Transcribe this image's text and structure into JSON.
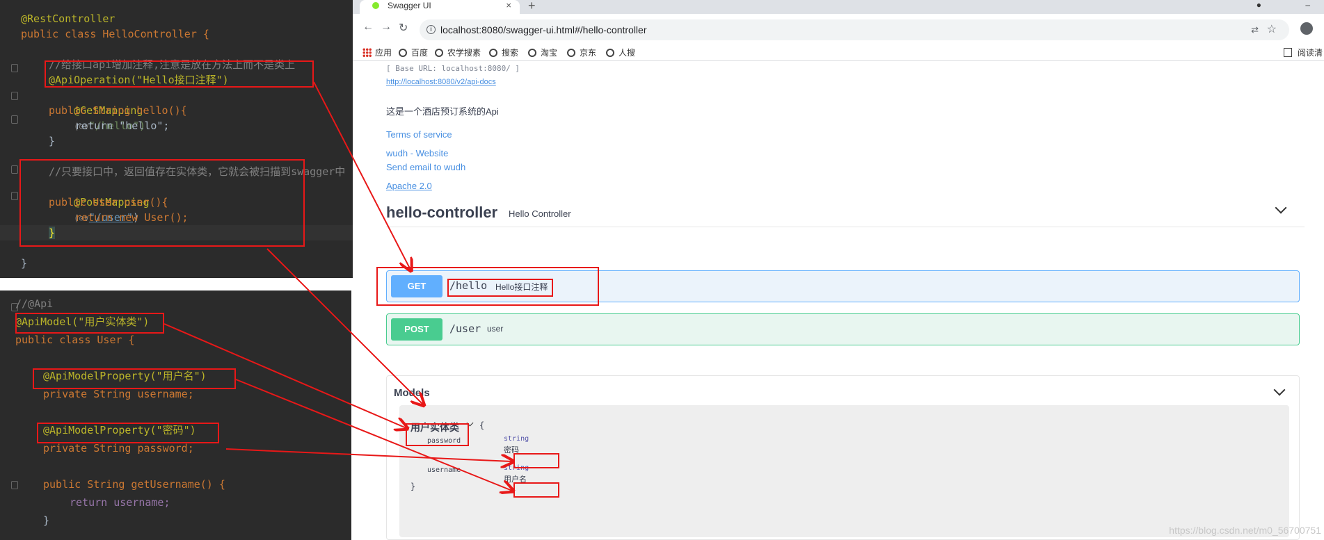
{
  "ide_top": {
    "lines": [
      "@RestController",
      "public class HelloController {",
      "",
      "//给接口api增加注释,注意是放在方法上而不是类上",
      "@ApiOperation(\"Hello接口注释\")",
      "@GetMapping",
      "\"/hello\")",
      "public String hello(){",
      "return \"hello\";",
      "}",
      "",
      "//只要接口中，返回值存在实体类，它就会被扫描到swagger中",
      "@PostMapping",
      "\"/user\"",
      "public User user(){",
      "return new User();",
      "}",
      "",
      "}"
    ],
    "param_hint": "(⊙∨",
    "paren_close": ")"
  },
  "ide_bottom": {
    "comment": "//@Api",
    "api_model": "@ApiModel(\"用户实体类\")",
    "class_decl": "public class User {",
    "prop1_ann": "@ApiModelProperty(\"用户名\")",
    "prop1_field": "private String username;",
    "prop2_ann": "@ApiModelProperty(\"密码\")",
    "prop2_field": "private String password;",
    "getter_decl": "public String getUsername() {",
    "getter_return": "return username;",
    "getter_close": "}"
  },
  "browser": {
    "tab_title": "Swagger UI",
    "tab_close": "×",
    "new_tab": "+",
    "window_controls": [
      "●",
      "–"
    ],
    "url": "localhost:8080/swagger-ui.html#/hello-controller",
    "nav": {
      "back": "←",
      "forward": "→",
      "reload": "↻"
    },
    "translate": "⇄",
    "star": "☆",
    "bookmarks": [
      "应用",
      "百度",
      "农学搜素",
      "搜索",
      "淘宝",
      "京东",
      "人搜"
    ],
    "reading_list": "阅读清"
  },
  "swagger": {
    "base_url": "[ Base URL: localhost:8080/ ]",
    "api_docs": "http://localhost:8080/v2/api-docs",
    "description": "这是一个酒店预订系统的Api",
    "terms": "Terms of service",
    "website": "wudh - Website",
    "email": "Send email to wudh",
    "license": "Apache 2.0",
    "tag": {
      "name": "hello-controller",
      "description": "Hello Controller"
    },
    "operations": [
      {
        "method": "GET",
        "path": "/hello",
        "summary": "Hello接口注释"
      },
      {
        "method": "POST",
        "path": "/user",
        "summary": "user"
      }
    ],
    "models_title": "Models",
    "model": {
      "name": "用户实体类",
      "open": "{",
      "close": "}",
      "properties": [
        {
          "name": "password",
          "type": "string",
          "description": "密码"
        },
        {
          "name": "username",
          "type": "string",
          "description": "用户名"
        }
      ]
    }
  },
  "watermark": "https://blog.csdn.net/m0_56700751",
  "colors": {
    "ide_bg": "#2b2b2b",
    "get": "#61affe",
    "post": "#49cc90",
    "annotation_red": "#e81818"
  }
}
